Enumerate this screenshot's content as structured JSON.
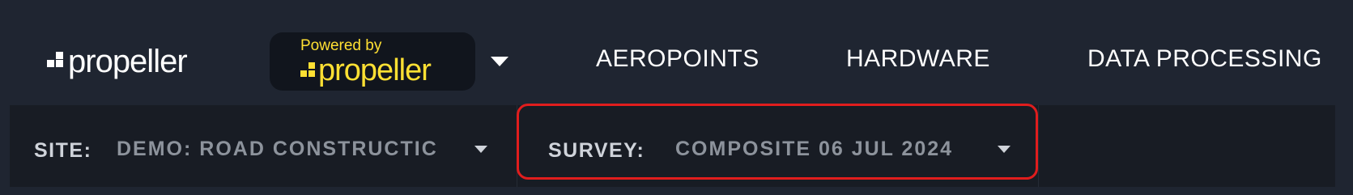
{
  "header": {
    "logo_text": "propeller",
    "powered_by": {
      "caption": "Powered by",
      "logo_text": "propeller"
    },
    "nav": [
      {
        "label": "AEROPOINTS"
      },
      {
        "label": "HARDWARE"
      },
      {
        "label": "DATA PROCESSING"
      }
    ]
  },
  "context_bar": {
    "site": {
      "label": "SITE:",
      "value": "DEMO: ROAD CONSTRUCTIC"
    },
    "survey": {
      "label": "SURVEY:",
      "value": "COMPOSITE 06 JUL 2024"
    }
  },
  "colors": {
    "header_bg": "#1f2531",
    "subbar_bg": "#181c24",
    "brand_yellow": "#ffe033",
    "highlight_red": "#e01d1d"
  }
}
